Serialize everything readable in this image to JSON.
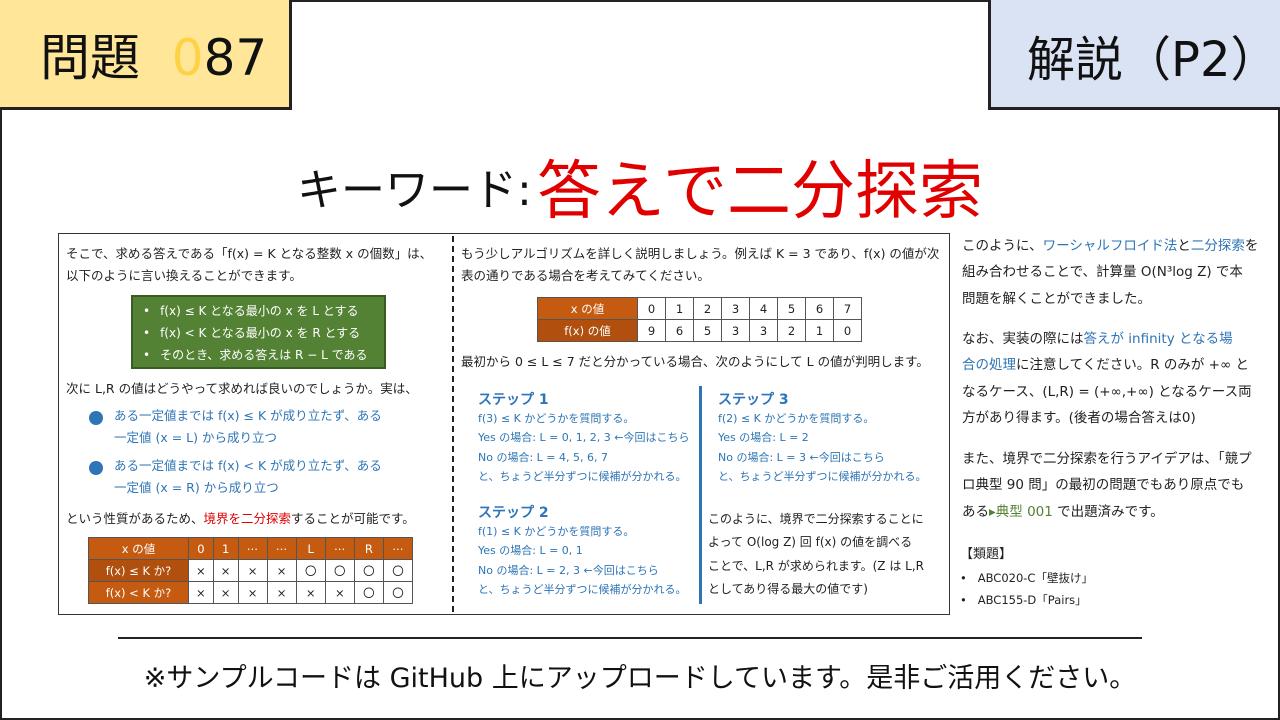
{
  "header": {
    "problem_label": "問題",
    "problem_num_dim": "0",
    "problem_num": "87",
    "section": "解説（P2）"
  },
  "keyword": {
    "label": "キーワード:",
    "value": "答えで二分探索"
  },
  "left": {
    "p1a": "そこで、求める答えである「f(x) = K となる整数 x の個数」は、",
    "p1b": "以下のように言い換えることができます。",
    "green": [
      "f(x) ≤ K となる最小の x を L とする",
      "f(x) < K となる最小の x を R とする",
      "そのとき、求める答えは R − L である"
    ],
    "p2": "次に L,R の値はどうやって求めれば良いのでしょうか。実は、",
    "b1a": "ある一定値までは  f(x) ≤ K  が成り立たず、ある",
    "b1b": "一定値 (x = L) から成り立つ",
    "b2a": "ある一定値までは  f(x) < K  が成り立たず、ある",
    "b2b": "一定値 (x = R) から成り立つ",
    "p3a": "という性質があるため、",
    "p3red": "境界を二分探索",
    "p3b": "することが可能です。",
    "table": {
      "header": [
        "x の値",
        "0",
        "1",
        "⋯",
        "⋯",
        "L",
        "⋯",
        "R",
        "⋯"
      ],
      "rows": [
        [
          "f(x) ≤ K か?",
          "×",
          "×",
          "×",
          "×",
          "〇",
          "〇",
          "〇",
          "〇"
        ],
        [
          "f(x) < K か?",
          "×",
          "×",
          "×",
          "×",
          "×",
          "×",
          "〇",
          "〇"
        ]
      ]
    }
  },
  "middle": {
    "p1a": "もう少しアルゴリズムを詳しく説明しましょう。例えば  K = 3 であり、f(x) の値が次",
    "p1b": "表の通りである場合を考えてみてください。",
    "table": {
      "header": [
        "x の値",
        "0",
        "1",
        "2",
        "3",
        "4",
        "5",
        "6",
        "7"
      ],
      "row": [
        "f(x) の値",
        "9",
        "6",
        "5",
        "3",
        "3",
        "2",
        "1",
        "0"
      ]
    },
    "p2": "最初から 0 ≤ L ≤ 7 だと分かっている場合、次のようにして  L の値が判明します。",
    "step1": {
      "title": "ステップ 1",
      "l1": "f(3) ≤ K かどうかを質問する。",
      "l2": "Yes の場合: L = 0, 1, 2, 3  ←今回はこちら",
      "l3": "No の場合: L = 4, 5, 6, 7",
      "l4": "と、ちょうど半分ずつに候補が分かれる。"
    },
    "step2": {
      "title": "ステップ 2",
      "l1": "f(1) ≤ K かどうかを質問する。",
      "l2": "Yes の場合: L = 0, 1",
      "l3": "No の場合: L = 2, 3  ←今回はこちら",
      "l4": "と、ちょうど半分ずつに候補が分かれる。"
    },
    "step3": {
      "title": "ステップ 3",
      "l1": "f(2) ≤ K かどうかを質問する。",
      "l2": "Yes の場合: L = 2",
      "l3": "No の場合: L = 3  ←今回はこちら",
      "l4": "と、ちょうど半分ずつに候補が分かれる。"
    },
    "c1": "このように、境界で二分探索することに",
    "c2": "よって  O(log Z) 回  f(x) の値を調べる",
    "c3": "ことで、L,R が求められます。(Z は L,R",
    "c4": "としてあり得る最大の値です)"
  },
  "side": {
    "s1a": "このように、",
    "s1link1": "ワーシャルフロイド法",
    "s1b": "と",
    "s1link2": "二分探索",
    "s1c": "を",
    "s1d": "組み合わせることで、計算量 O(N³log Z) で本",
    "s1e": "問題を解くことができました。",
    "s2a": "なお、実装の際には",
    "s2link": "答えが infinity となる場",
    "s2link2": "合の処理",
    "s2b": "に注意してください。R のみが +∞ と",
    "s2c": "なるケース、(L,R) = (+∞,+∞) となるケース両",
    "s2d": "方があり得ます。(後者の場合答えは0)",
    "s3a": "また、境界で二分探索を行うアイデアは、「競プ",
    "s3b": "ロ典型 90 問」の最初の問題でもあり原点でも",
    "s3c": "ある",
    "s3link": "▸典型 001",
    "s3d": " で出題済みです。",
    "related_title": "【類題】",
    "related": [
      "ABC020-C「壁抜け」",
      "ABC155-D「Pairs」"
    ]
  },
  "footer": "※サンプルコードは GitHub 上にアップロードしています。是非ご活用ください。"
}
